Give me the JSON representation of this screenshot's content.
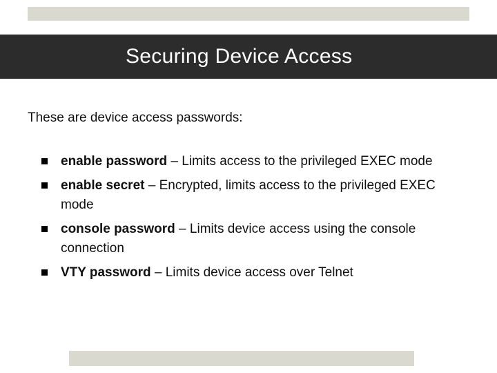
{
  "title": "Securing Device Access",
  "intro": "These are device access passwords:",
  "items": [
    {
      "term": "enable password",
      "sep": " – ",
      "desc": "Limits access to the privileged EXEC mode"
    },
    {
      "term": "enable secret",
      "sep": "  – ",
      "desc": "Encrypted, limits access to the privileged EXEC mode"
    },
    {
      "term": "console password",
      "sep": "  – ",
      "desc": "Limits device access using the console connection"
    },
    {
      "term": "VTY password",
      "sep": " – ",
      "desc": "Limits device access over Telnet"
    }
  ]
}
